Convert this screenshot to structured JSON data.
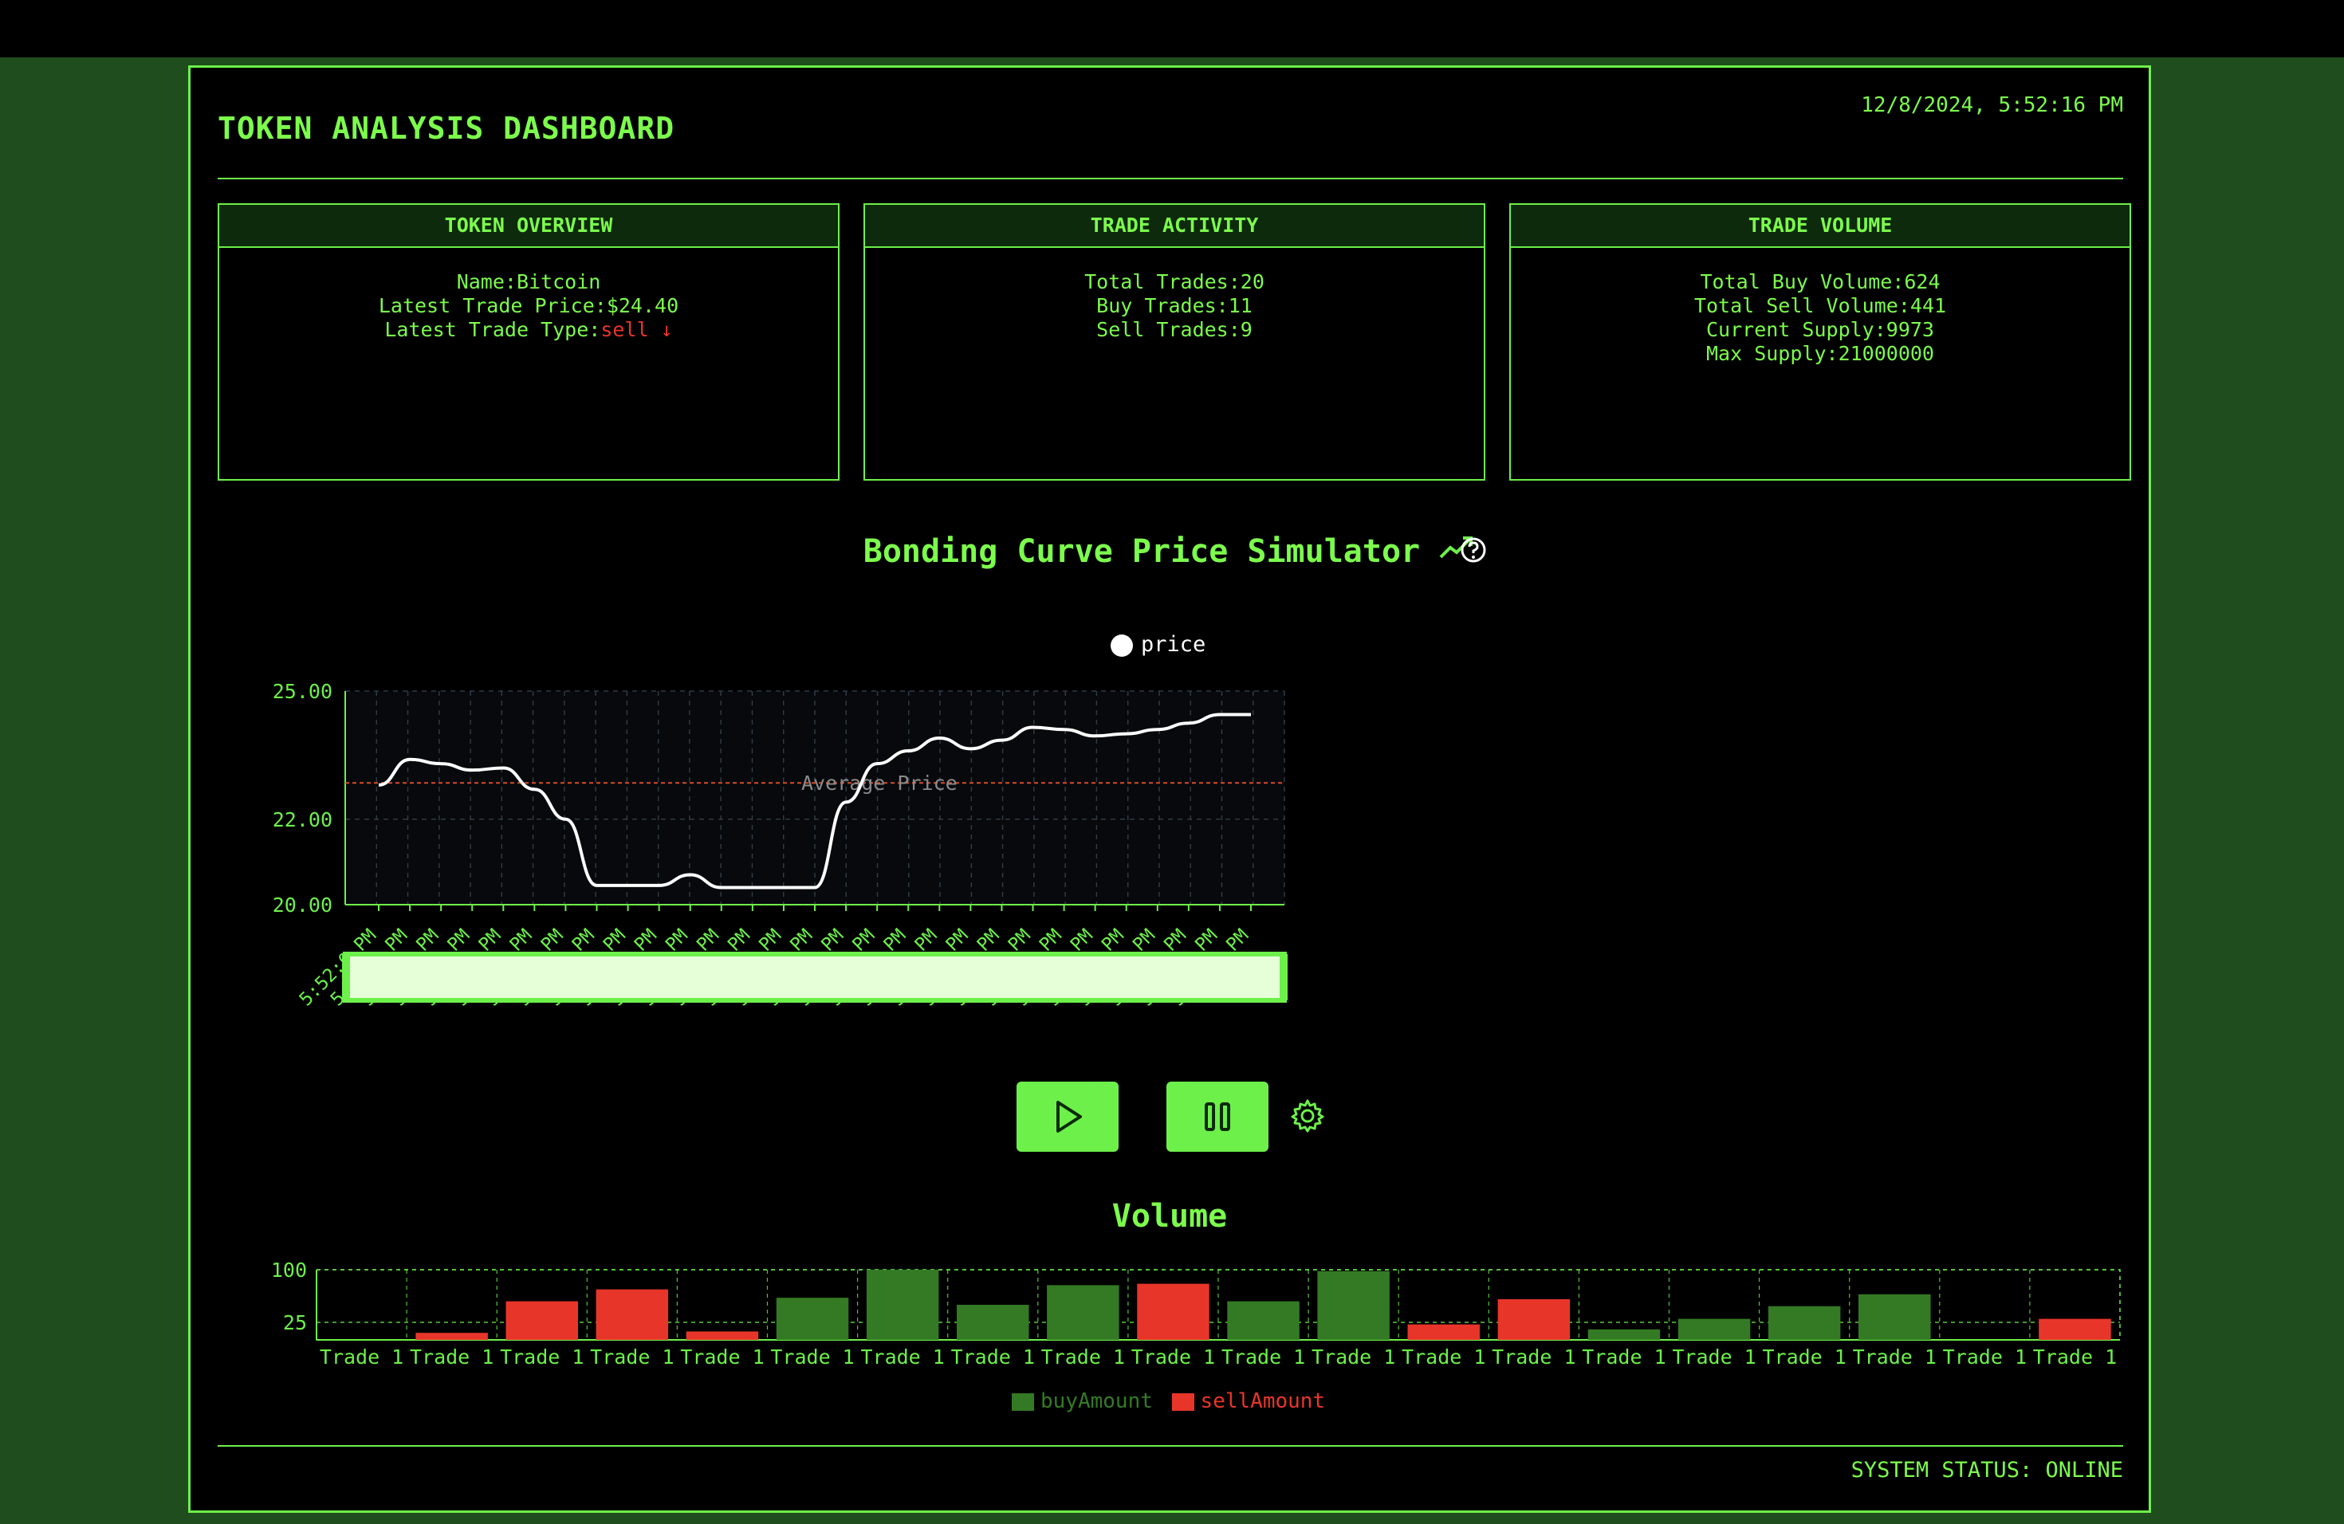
{
  "header": {
    "title": "TOKEN ANALYSIS DASHBOARD",
    "datetime": "12/8/2024, 5:52:16 PM"
  },
  "cards": {
    "overview": {
      "heading": "TOKEN OVERVIEW",
      "name_label": "Name:",
      "name_value": "Bitcoin",
      "price_label": "Latest Trade Price:",
      "price_value": "$24.40",
      "type_label": "Latest Trade Type:",
      "type_value": "sell ↓"
    },
    "activity": {
      "heading": "TRADE ACTIVITY",
      "total_label": "Total Trades:",
      "total_value": "20",
      "buy_label": "Buy Trades:",
      "buy_value": "11",
      "sell_label": "Sell Trades:",
      "sell_value": "9"
    },
    "volume": {
      "heading": "TRADE VOLUME",
      "buy_label": "Total Buy Volume:",
      "buy_value": "624",
      "sell_label": "Total Sell Volume:",
      "sell_value": "441",
      "supply_label": "Current Supply:",
      "supply_value": "9973",
      "max_label": "Max Supply:",
      "max_value": "21000000"
    }
  },
  "simulator": {
    "title": "Bonding Curve Price Simulator",
    "legend": "price",
    "average_label": "Average Price"
  },
  "volume_section": {
    "title": "Volume"
  },
  "footer": {
    "status": "SYSTEM STATUS: ONLINE"
  },
  "colors": {
    "accent": "#6df04a",
    "buy": "#347a24",
    "sell": "#e8352a",
    "avg_line": "#d94c2a"
  },
  "chart_data": [
    {
      "type": "line",
      "series": [
        {
          "name": "price",
          "values": [
            22.8,
            23.4,
            23.3,
            23.15,
            23.2,
            22.7,
            22.0,
            20.45,
            20.45,
            20.45,
            20.7,
            20.4,
            20.4,
            20.4,
            20.4,
            22.4,
            23.3,
            23.6,
            23.9,
            23.65,
            23.85,
            24.15,
            24.1,
            23.95,
            24.0,
            24.1,
            24.25,
            24.45,
            24.45
          ]
        }
      ],
      "x_tick_label": "5:52:0",
      "x_tick_suffix": "PM",
      "yticks": [
        "25.00",
        "22.00",
        "20.00"
      ],
      "ylim": [
        20,
        25
      ],
      "average": 22.85,
      "legend": "top-center",
      "grid": true
    },
    {
      "type": "bar",
      "categories": [
        "Trade 1",
        "Trade 1",
        "Trade 1",
        "Trade 1",
        "Trade 1",
        "Trade 1",
        "Trade 1",
        "Trade 1",
        "Trade 1",
        "Trade 1",
        "Trade 1",
        "Trade 1",
        "Trade 1",
        "Trade 1",
        "Trade 1",
        "Trade 1",
        "Trade 1",
        "Trade 1",
        "Trade 1",
        "Trade 1"
      ],
      "series": [
        {
          "name": "buyAmount",
          "values": [
            0,
            0,
            0,
            0,
            0,
            60,
            100,
            50,
            78,
            0,
            55,
            98,
            0,
            0,
            15,
            30,
            48,
            65,
            0,
            0
          ]
        },
        {
          "name": "sellAmount",
          "values": [
            0,
            10,
            55,
            72,
            12,
            0,
            0,
            0,
            0,
            80,
            0,
            0,
            22,
            58,
            0,
            0,
            0,
            0,
            0,
            30
          ]
        }
      ],
      "yticks": [
        "100",
        "25"
      ],
      "ylim": [
        0,
        100
      ],
      "legend": "bottom-center",
      "grid": true
    }
  ]
}
